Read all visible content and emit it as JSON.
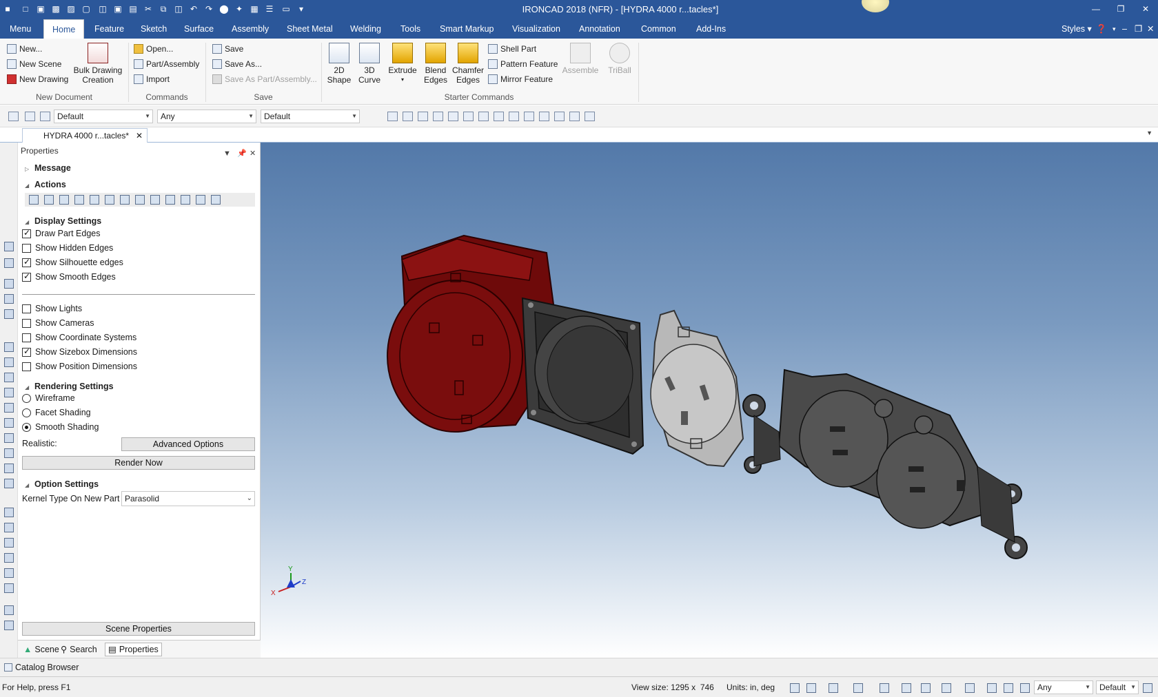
{
  "window": {
    "title": "IRONCAD 2018 (NFR) - [HYDRA 4000 r...tacles*]"
  },
  "menu": {
    "items": [
      "Menu",
      "Home",
      "Feature",
      "Sketch",
      "Surface",
      "Assembly",
      "Sheet Metal",
      "Welding",
      "Tools",
      "Smart Markup",
      "Visualization",
      "Annotation",
      "Common",
      "Add-Ins"
    ],
    "active": "Home",
    "styles_label": "Styles"
  },
  "ribbon": {
    "new_document": {
      "new": "New...",
      "new_scene": "New Scene",
      "new_drawing": "New Drawing",
      "bulk_line1": "Bulk Drawing",
      "bulk_line2": "Creation",
      "label": "New Document"
    },
    "commands": {
      "open": "Open...",
      "part_assembly": "Part/Assembly",
      "import": "Import",
      "label": "Commands"
    },
    "save": {
      "save": "Save",
      "save_as": "Save As...",
      "save_as_part": "Save As Part/Assembly...",
      "label": "Save"
    },
    "starter": {
      "shape_l1": "2D",
      "shape_l2": "Shape",
      "curve_l1": "3D",
      "curve_l2": "Curve",
      "extrude": "Extrude",
      "blend_l1": "Blend",
      "blend_l2": "Edges",
      "chamfer_l1": "Chamfer",
      "chamfer_l2": "Edges",
      "shell_part": "Shell Part",
      "pattern_feature": "Pattern Feature",
      "mirror_feature": "Mirror Feature",
      "assemble": "Assemble",
      "triball": "TriBall",
      "label": "Starter Commands"
    }
  },
  "toolbar": {
    "combo1": "Default",
    "combo2": "Any",
    "combo3": "Default"
  },
  "doc_tab": {
    "label": "HYDRA 4000 r...tacles*"
  },
  "properties": {
    "title": "Properties",
    "message": "Message",
    "actions": "Actions",
    "display_settings": "Display Settings",
    "draw_part_edges": "Draw Part Edges",
    "show_hidden_edges": "Show Hidden Edges",
    "show_silhouette_edges": "Show Silhouette edges",
    "show_smooth_edges": "Show Smooth Edges",
    "show_lights": "Show Lights",
    "show_cameras": "Show Cameras",
    "show_coordinate_systems": "Show Coordinate Systems",
    "show_sizebox_dimensions": "Show Sizebox Dimensions",
    "show_position_dimensions": "Show Position Dimensions",
    "rendering_settings": "Rendering Settings",
    "wireframe": "Wireframe",
    "facet_shading": "Facet Shading",
    "smooth_shading": "Smooth Shading",
    "realistic": "Realistic:",
    "advanced_options": "Advanced Options",
    "render_now": "Render Now",
    "option_settings": "Option Settings",
    "kernel_type": "Kernel Type On New Part",
    "kernel_value": "Parasolid",
    "scene_properties": "Scene Properties",
    "checks": {
      "draw_part_edges": true,
      "show_hidden_edges": false,
      "show_silhouette_edges": true,
      "show_smooth_edges": true,
      "show_lights": false,
      "show_cameras": false,
      "show_coordinate_systems": false,
      "show_sizebox_dimensions": true,
      "show_position_dimensions": false
    },
    "shading_selected": "Smooth Shading"
  },
  "panel_tabs": {
    "scene": "Scene",
    "search": "Search",
    "properties": "Properties"
  },
  "axis": {
    "x": "X",
    "y": "Y",
    "z": "Z"
  },
  "catalog_browser": "Catalog Browser",
  "status": {
    "help": "For Help, press F1",
    "view_size": "View size: 1295 x  746",
    "units": "Units: in, deg",
    "any": "Any",
    "default": "Default"
  },
  "colors": {
    "title_bar": "#2b579a",
    "part_red": "#8b0f0f",
    "part_dark": "#3a3a3a",
    "part_light": "#b9b9b9"
  }
}
